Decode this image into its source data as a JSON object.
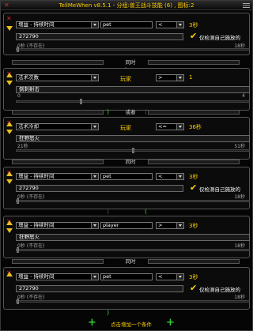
{
  "title": "TellMeWhen v8.5.1 - 分组:兽王战斗技能 (6) , 图标:2",
  "rows": [
    {
      "type": "增益 - 持续时间",
      "name": "pet",
      "op": "<",
      "value": "3秒",
      "field": "272790",
      "checkbox": "仅检测自己施放的",
      "min": "0秒 (不存在)",
      "max": "18秒",
      "thumb": 0.0
    },
    {
      "type": "法术次数",
      "player_label": "玩家",
      "op": ">",
      "value": "1",
      "field": "倒刺射击",
      "min": "0",
      "max": "4",
      "thumb": 0.28
    },
    {
      "type": "法术冷却",
      "player_label": "玩家",
      "op": "<=",
      "value": "36秒",
      "field": "狂野怒火",
      "min": "21秒",
      "max": "51秒",
      "thumb": 0.5
    },
    {
      "type": "增益 - 持续时间",
      "name": "pet",
      "op": "<",
      "value": "3秒",
      "field": "272790",
      "checkbox": "仅检测自己施放的",
      "min": "0秒 (不存在)",
      "max": "18秒",
      "thumb": 0.0
    },
    {
      "type": "增益 - 持续时间",
      "name": "player",
      "op": ">",
      "value": "3秒",
      "field": "狂野怒火",
      "min": "0秒 (不存在)",
      "max": "18秒",
      "thumb": 0.0
    },
    {
      "type": "增益 - 持续时间",
      "name": "pet",
      "op": "<",
      "value": "3秒",
      "field": "272790",
      "checkbox": "仅检测自己施放的",
      "min": "0秒 (不存在)",
      "max": "18秒",
      "thumb": 0.0
    }
  ],
  "conjunctions": [
    "同时",
    "或者",
    "同时",
    "同时"
  ],
  "add_condition": "点击增加一个条件"
}
